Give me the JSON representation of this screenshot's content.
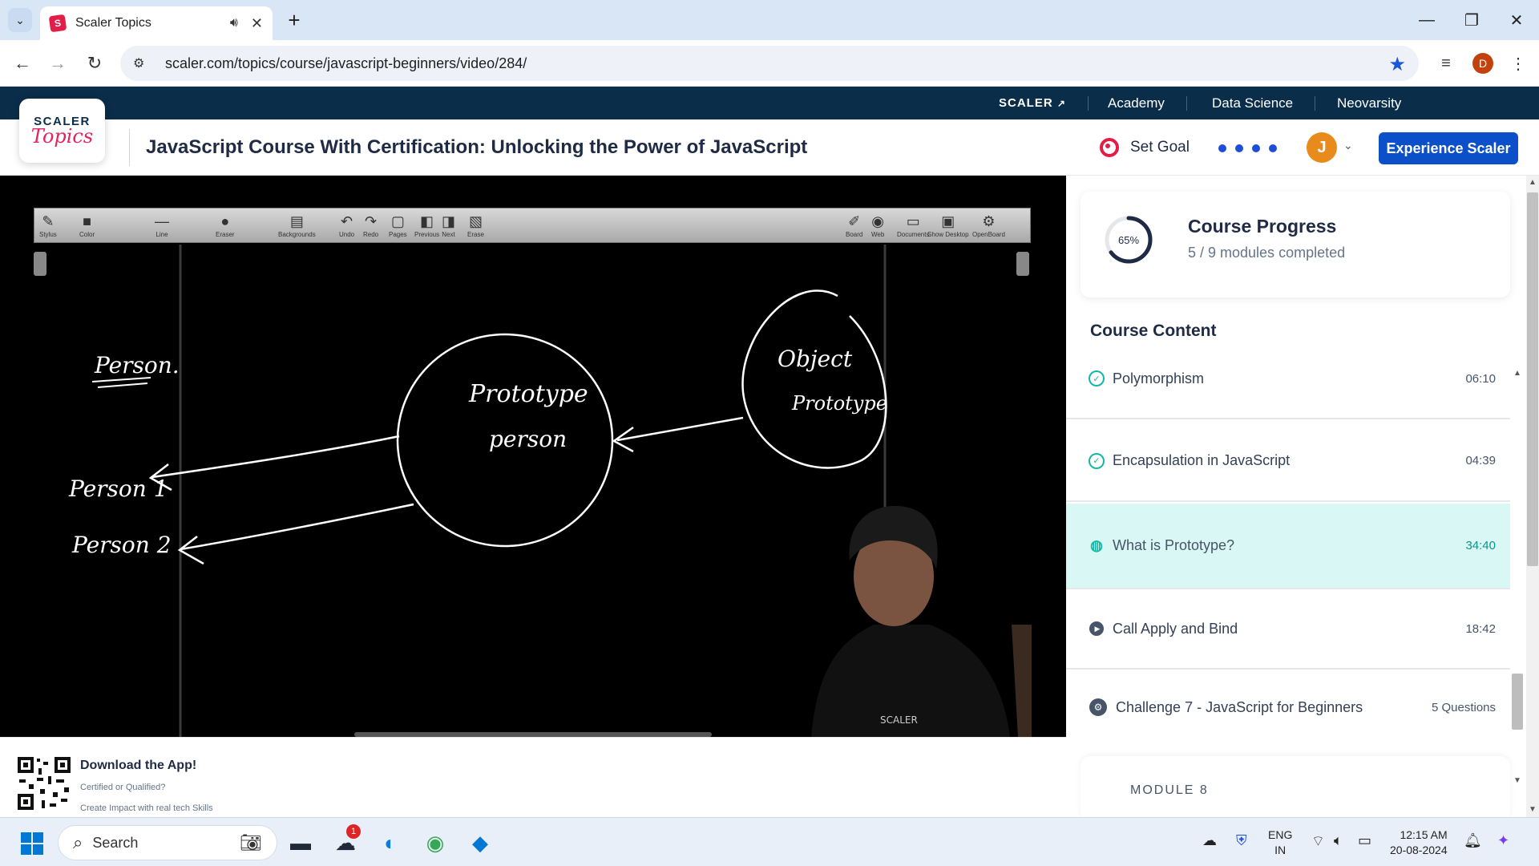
{
  "browser": {
    "tab_title": "Scaler Topics",
    "url": "scaler.com/topics/course/javascript-beginners/video/284/",
    "profile_initial": "D"
  },
  "topnav": {
    "brand": "SCALER",
    "links": [
      "Academy",
      "Data Science",
      "Neovarsity"
    ]
  },
  "header": {
    "logo_line1": "SCALER",
    "logo_line2": "Topics",
    "course_title": "JavaScript Course With Certification: Unlocking the Power of JavaScript",
    "set_goal": "Set Goal",
    "avatar_initial": "J",
    "cta": "Experience Scaler",
    "accent": "#0b4fc9"
  },
  "board": {
    "tools": [
      {
        "label": "Stylus",
        "icon": "✎"
      },
      {
        "label": "Color",
        "icon": "■"
      },
      {
        "label": "Line",
        "icon": "—"
      },
      {
        "label": "Eraser",
        "icon": "●"
      },
      {
        "label": "Backgrounds",
        "icon": "▤"
      },
      {
        "label": "Undo",
        "icon": "↶"
      },
      {
        "label": "Redo",
        "icon": "↷"
      },
      {
        "label": "Pages",
        "icon": "▢"
      },
      {
        "label": "Previous",
        "icon": "◧"
      },
      {
        "label": "Next",
        "icon": "◨"
      },
      {
        "label": "Erase",
        "icon": "▧"
      },
      {
        "label": "Board",
        "icon": "✐"
      },
      {
        "label": "Web",
        "icon": "◉"
      },
      {
        "label": "Documents",
        "icon": "▭"
      },
      {
        "label": "Show Desktop",
        "icon": "▣"
      },
      {
        "label": "OpenBoard",
        "icon": "⚙"
      }
    ],
    "handwriting": {
      "person": "Person.",
      "proto_line1": "Prototype",
      "proto_line2": "person",
      "obj_line1": "Object",
      "obj_line2": "Prototype",
      "person1": "Person 1",
      "person2": "Person 2"
    },
    "shirt_text": "SCALER"
  },
  "sidebar": {
    "progress_percent": 65,
    "progress_label": "65%",
    "progress_title": "Course Progress",
    "progress_sub": "5 / 9 modules completed",
    "content_label": "Course Content",
    "lessons": [
      {
        "label": "Polymorphism",
        "time": "06:10",
        "status": "done"
      },
      {
        "label": "Encapsulation in JavaScript",
        "time": "04:39",
        "status": "done"
      },
      {
        "label": "What is Prototype?",
        "time": "34:40",
        "status": "playing"
      },
      {
        "label": "Call Apply and Bind",
        "time": "18:42",
        "status": "todo"
      },
      {
        "label": "Challenge 7 - JavaScript for Beginners",
        "time": "5 Questions",
        "status": "challenge"
      }
    ],
    "next_module": "MODULE 8"
  },
  "app_banner": {
    "title": "Download the App!",
    "line1": "Certified or Qualified?",
    "line2": "Create Impact with real tech Skills"
  },
  "taskbar": {
    "search": "Search",
    "notification_count": "1",
    "lang_line1": "ENG",
    "lang_line2": "IN",
    "time": "12:15 AM",
    "date": "20-08-2024"
  }
}
